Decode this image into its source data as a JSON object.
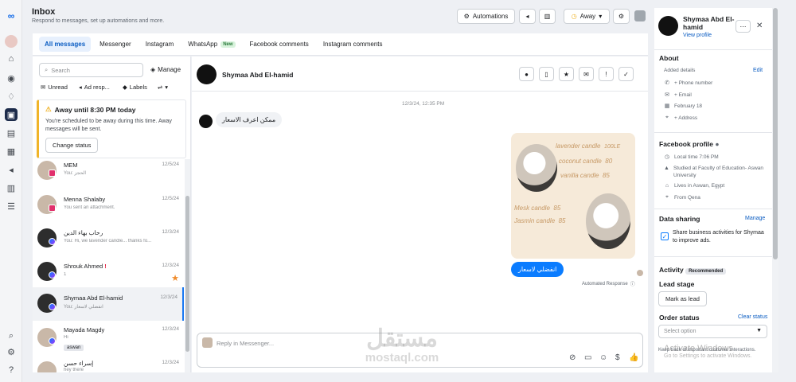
{
  "header": {
    "title": "Inbox",
    "subtitle": "Respond to messages, set up automations and more.",
    "automations_label": "Automations",
    "status_label": "Away"
  },
  "tabs": [
    {
      "label": "All messages",
      "active": true
    },
    {
      "label": "Messenger"
    },
    {
      "label": "Instagram"
    },
    {
      "label": "WhatsApp",
      "badge": "New"
    },
    {
      "label": "Facebook comments"
    },
    {
      "label": "Instagram comments"
    }
  ],
  "list": {
    "search_placeholder": "Search",
    "manage_label": "Manage",
    "filters": [
      "Unread",
      "Ad resp...",
      "Labels"
    ],
    "away": {
      "title": "Away until 8:30 PM today",
      "body": "You're scheduled to be away during this time. Away messages will be sent.",
      "button": "Change status"
    },
    "conversations": [
      {
        "name": "MEM",
        "date": "12/5/24",
        "snippet": "You: الحجز",
        "channel": "instagram"
      },
      {
        "name": "Menna Shalaby",
        "date": "12/5/24",
        "snippet": "You sent an attachment.",
        "channel": "instagram"
      },
      {
        "name": "رحاب بهاء الدين",
        "date": "12/3/24",
        "snippet": "You: Hi, we lavender candle... thanks fo...",
        "channel": "messenger"
      },
      {
        "name": "Shrouk Ahmed",
        "date": "12/3/24",
        "snippet": "1",
        "channel": "messenger",
        "flag": "!",
        "starred": true
      },
      {
        "name": "Shymaa Abd El-hamid",
        "date": "12/3/24",
        "snippet": "You: انفضلي لاسعار",
        "channel": "messenger",
        "selected": true
      },
      {
        "name": "Mayada Magdy",
        "date": "12/3/24",
        "snippet": "Hi",
        "channel": "messenger",
        "tag": "aswan"
      },
      {
        "name": "إسراء حسن",
        "date": "12/3/24",
        "snippet": "hey there",
        "channel": "messenger"
      }
    ]
  },
  "chat": {
    "contact_name": "Shymaa Abd El-hamid",
    "timestamp": "12/3/24, 12:35 PM",
    "incoming_text": "ممكن اعرف الاسعار",
    "card_lines": [
      {
        "text": "lavender candle",
        "price": "100LE"
      },
      {
        "text": "coconut candle",
        "price": "80"
      },
      {
        "text": "vanilla candle",
        "price": "85"
      },
      {
        "text": "Mesk candle",
        "price": "85"
      },
      {
        "text": "Jasmin candle",
        "price": "85"
      }
    ],
    "outgoing_text": "انفضلي لاسعار",
    "automated_label": "Automated Response",
    "reply_placeholder": "Reply in Messenger..."
  },
  "profile": {
    "name": "Shymaa Abd El-hamid",
    "view_profile": "View profile",
    "about_title": "About",
    "added_details": "Added details",
    "edit": "Edit",
    "phone": "+ Phone number",
    "email": "+ Email",
    "birthday": "February 18",
    "address": "+ Address",
    "fb_title": "Facebook profile",
    "local_time": "Local time 7:06 PM",
    "studied": "Studied at Faculty of Education- Aswan University",
    "lives": "Lives in Aswan, Egypt",
    "from": "From Qena",
    "sharing_title": "Data sharing",
    "sharing_manage": "Manage",
    "sharing_text": "Share business activities for Shymaa to improve ads.",
    "activity_title": "Activity",
    "recommended": "Recommended",
    "lead_title": "Lead stage",
    "mark_lead": "Mark as lead",
    "order_title": "Order status",
    "clear_status": "Clear status",
    "select_option": "Select option",
    "keep_track": "Keep track of important customer interactions."
  },
  "overlay": {
    "watermark_arabic": "مستقل",
    "watermark_latin": "mostaql.com",
    "windows_title": "Activate Windows",
    "windows_sub": "Go to Settings to activate Windows."
  },
  "colors": {
    "accent": "#0a7cff",
    "rail_active": "#1c2b4a",
    "away_warning": "#f0b429"
  }
}
